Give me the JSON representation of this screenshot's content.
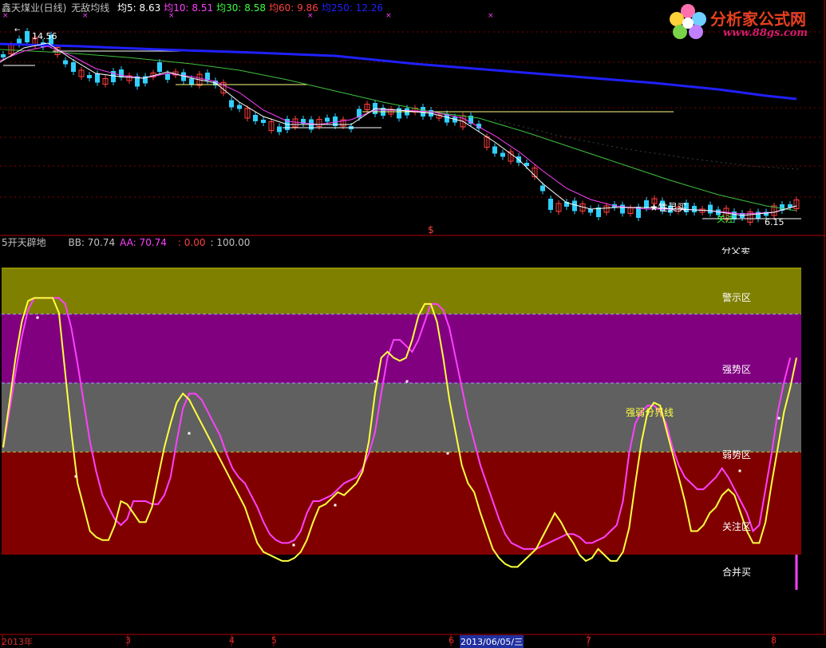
{
  "main_panel": {
    "stock_title": "鑫天煤业(日线)",
    "indicator_name": "无敌均线",
    "ma_readouts": [
      {
        "label": "均5: 8.63",
        "color": "#ffffff"
      },
      {
        "label": "均10: 8.51",
        "color": "#ff40ff"
      },
      {
        "label": "均30: 8.58",
        "color": "#40ff40"
      },
      {
        "label": "均60: 9.86",
        "color": "#ff4040"
      },
      {
        "label": "均250: 12.26",
        "color": "#2020ff"
      }
    ],
    "high_annotation": "14.56",
    "low_annotation": "6.15",
    "signal_text": "★牲灵买",
    "signal_text_2": "关注",
    "dollar_marker": "$"
  },
  "sub_panel": {
    "indicator_name": "5开天辟地",
    "readouts": [
      {
        "label": "BB: 70.74",
        "color": "#c0c0c0"
      },
      {
        "label": "AA: 70.74",
        "color": "#ff40ff"
      },
      {
        "label": ": 0.00",
        "color": "#ff4040"
      },
      {
        "label": ": 100.00",
        "color": "#c0c0c0"
      }
    ],
    "top_cut_label": "分父卖",
    "zones": [
      {
        "label": "警示区",
        "color": "#808000"
      },
      {
        "label": "强势区",
        "color": "#800080"
      },
      {
        "label": "弱势区",
        "color": "#606060"
      },
      {
        "label": "关注区",
        "color": "#800000"
      },
      {
        "label": "合并买",
        "color": "#000000"
      }
    ],
    "divider_label": "强弱分界线"
  },
  "x_axis": {
    "dates": [
      "2013年",
      "3",
      "4",
      "5",
      "6",
      "2013/06/05/三",
      "7",
      "8"
    ]
  },
  "logo": {
    "name": "分析家公式网",
    "url": "www.88gs.com"
  },
  "chart_data": [
    {
      "type": "candlestick",
      "title": "鑫天煤业(日线)",
      "x": [
        "2013年",
        "3",
        "4",
        "5",
        "6",
        "2013/06/05/三",
        "7",
        "8"
      ],
      "series": [
        {
          "name": "均5",
          "color": "#ffffff",
          "last": 8.63
        },
        {
          "name": "均10",
          "color": "#ff40ff",
          "last": 8.51
        },
        {
          "name": "均30",
          "color": "#40ff40",
          "last": 8.58
        },
        {
          "name": "均60",
          "color": "#ff4040",
          "last": 9.86
        },
        {
          "name": "均250",
          "color": "#2020ff",
          "last": 12.26
        }
      ],
      "annotations": [
        "14.56",
        "6.15"
      ]
    },
    {
      "type": "line",
      "title": "5开天辟地",
      "ylim": [
        0,
        100
      ],
      "series": [
        {
          "name": "BB",
          "color": "#ffff40",
          "last": 70.74,
          "values": [
            40,
            55,
            70,
            82,
            89,
            90,
            90,
            90,
            90,
            85,
            65,
            45,
            28,
            20,
            12,
            10,
            9,
            9,
            14,
            22,
            21,
            18,
            15,
            15,
            20,
            30,
            40,
            48,
            55,
            58,
            56,
            52,
            48,
            44,
            40,
            36,
            32,
            28,
            24,
            20,
            14,
            8,
            5,
            4,
            3,
            2,
            2,
            3,
            5,
            9,
            15,
            20,
            21,
            23,
            25,
            24,
            26,
            28,
            32,
            42,
            58,
            70,
            72,
            70,
            69,
            70,
            76,
            84,
            88,
            88,
            82,
            70,
            56,
            45,
            34,
            28,
            25,
            18,
            12,
            6,
            3,
            1,
            0,
            0,
            2,
            4,
            6,
            10,
            14,
            18,
            15,
            11,
            8,
            4,
            2,
            3,
            6,
            4,
            2,
            2,
            5,
            13,
            28,
            42,
            52,
            55,
            54,
            46,
            38,
            30,
            22,
            12,
            12,
            14,
            18,
            20,
            24,
            26,
            24,
            18,
            12,
            8,
            8,
            15,
            28,
            40,
            52,
            60,
            70
          ]
        },
        {
          "name": "AA",
          "color": "#ff40ff",
          "last": 70.74,
          "values": [
            40,
            52,
            65,
            77,
            86,
            90,
            90,
            90,
            90,
            90,
            88,
            80,
            68,
            55,
            42,
            32,
            24,
            20,
            16,
            14,
            16,
            22,
            22,
            22,
            21,
            21,
            24,
            30,
            42,
            53,
            58,
            58,
            56,
            52,
            48,
            44,
            38,
            33,
            30,
            28,
            24,
            20,
            15,
            11,
            9,
            8,
            8,
            9,
            12,
            18,
            22,
            22,
            23,
            24,
            26,
            28,
            29,
            30,
            33,
            38,
            45,
            58,
            70,
            76,
            76,
            74,
            72,
            76,
            82,
            88,
            88,
            86,
            80,
            70,
            60,
            50,
            42,
            34,
            28,
            22,
            16,
            11,
            8,
            7,
            6,
            6,
            6,
            7,
            8,
            9,
            10,
            11,
            11,
            10,
            8,
            8,
            9,
            10,
            12,
            14,
            22,
            38,
            48,
            52,
            54,
            54,
            52,
            48,
            40,
            34,
            30,
            28,
            26,
            26,
            28,
            30,
            33,
            30,
            26,
            22,
            18,
            12,
            14,
            26,
            38,
            52,
            62,
            70
          ]
        },
        {
          "name": "",
          "color": "#ff4040",
          "last": 0.0
        },
        {
          "name": "",
          "color": "#c0c0c0",
          "last": 100.0
        }
      ],
      "zones": [
        {
          "label": "警示区",
          "from": 80,
          "to": 100
        },
        {
          "label": "强势区",
          "from": 50,
          "to": 80
        },
        {
          "label": "弱势区",
          "from": 20,
          "to": 50
        },
        {
          "label": "关注区",
          "from": 0,
          "to": 20
        },
        {
          "label": "合并买",
          "from": -30,
          "to": 0
        }
      ],
      "annotations": [
        "强弱分界线"
      ]
    }
  ]
}
